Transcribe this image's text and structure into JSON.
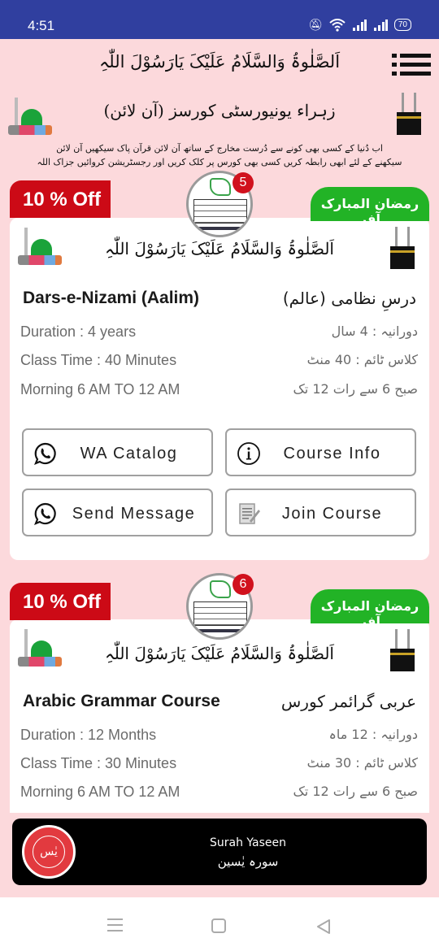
{
  "status_bar": {
    "time": "4:51",
    "icons": [
      "mute-icon",
      "wifi-icon",
      "signal-icon",
      "signal-icon"
    ],
    "battery": "70"
  },
  "header": {
    "salawat": "اَلصَّلٰوۃُ وَالسَّلَامُ عَلَيْکَ يَارَسُوْلَ اللّٰہِ",
    "menu_icon": "menu-icon",
    "university_title": "زہراء یونیورسٹی کورسز (آن لائن)",
    "intro_line_1": "اب دُنیا کے کسی بھی کونے سے دُرست مخارج کے ساتھ آن لائن قرآن پاک سیکھیں آن لائن",
    "intro_line_2": "سیکھنے کے لئے ابھی رابطہ کریں کسی بھی کورس پر کلک کریں اور رجسٹریشن کروائیں جزاک اللہ خیرا"
  },
  "courses": [
    {
      "discount": "10 % Off",
      "offer": "رمضان المبارک آفر",
      "count": "5",
      "salawat": "اَلصَّلٰوۃُ وَالسَّلَامُ عَلَيْکَ يَارَسُوْلَ اللّٰہِ",
      "title_en": "Dars-e-Nizami (Aalim)",
      "title_ur": "درسِ نظامی (عالم)",
      "duration_en": "Duration : 4 years",
      "duration_ur": "دورانیہ : 4 سال",
      "class_time_en": "Class Time : 40 Minutes",
      "class_time_ur": "کلاس ٹائم : 40 منٹ",
      "timing_en": "Morning 6 AM TO 12 AM",
      "timing_ur": "صبح 6 سے رات 12 تک",
      "buttons": {
        "wa_catalog": "WA Catalog",
        "course_info": "Course Info",
        "send_message": "Send Message",
        "join_course": "Join Course"
      }
    },
    {
      "discount": "10 % Off",
      "offer": "رمضان المبارک آفر",
      "count": "6",
      "salawat": "اَلصَّلٰوۃُ وَالسَّلَامُ عَلَيْکَ يَارَسُوْلَ اللّٰہِ",
      "title_en": "Arabic Grammar Course",
      "title_ur": "عربی گرائمر کورس",
      "duration_en": "Duration : 12 Months",
      "duration_ur": "دورانیہ : 12 ماہ",
      "class_time_en": "Class Time : 30 Minutes",
      "class_time_ur": "کلاس ٹائم : 30 منٹ",
      "timing_en": "Morning 6 AM TO 12 AM",
      "timing_ur": "صبح 6 سے رات 12 تک"
    }
  ],
  "surah_banner": {
    "title_en": "Surah Yaseen",
    "title_ur": "سورہ یٰسین",
    "logo_text": "یٰس"
  },
  "colors": {
    "status_bar": "#303f9f",
    "background": "#fcd9dc",
    "discount_red": "#cc0a16",
    "offer_green": "#22b326",
    "count_badge": "#d1111d"
  }
}
